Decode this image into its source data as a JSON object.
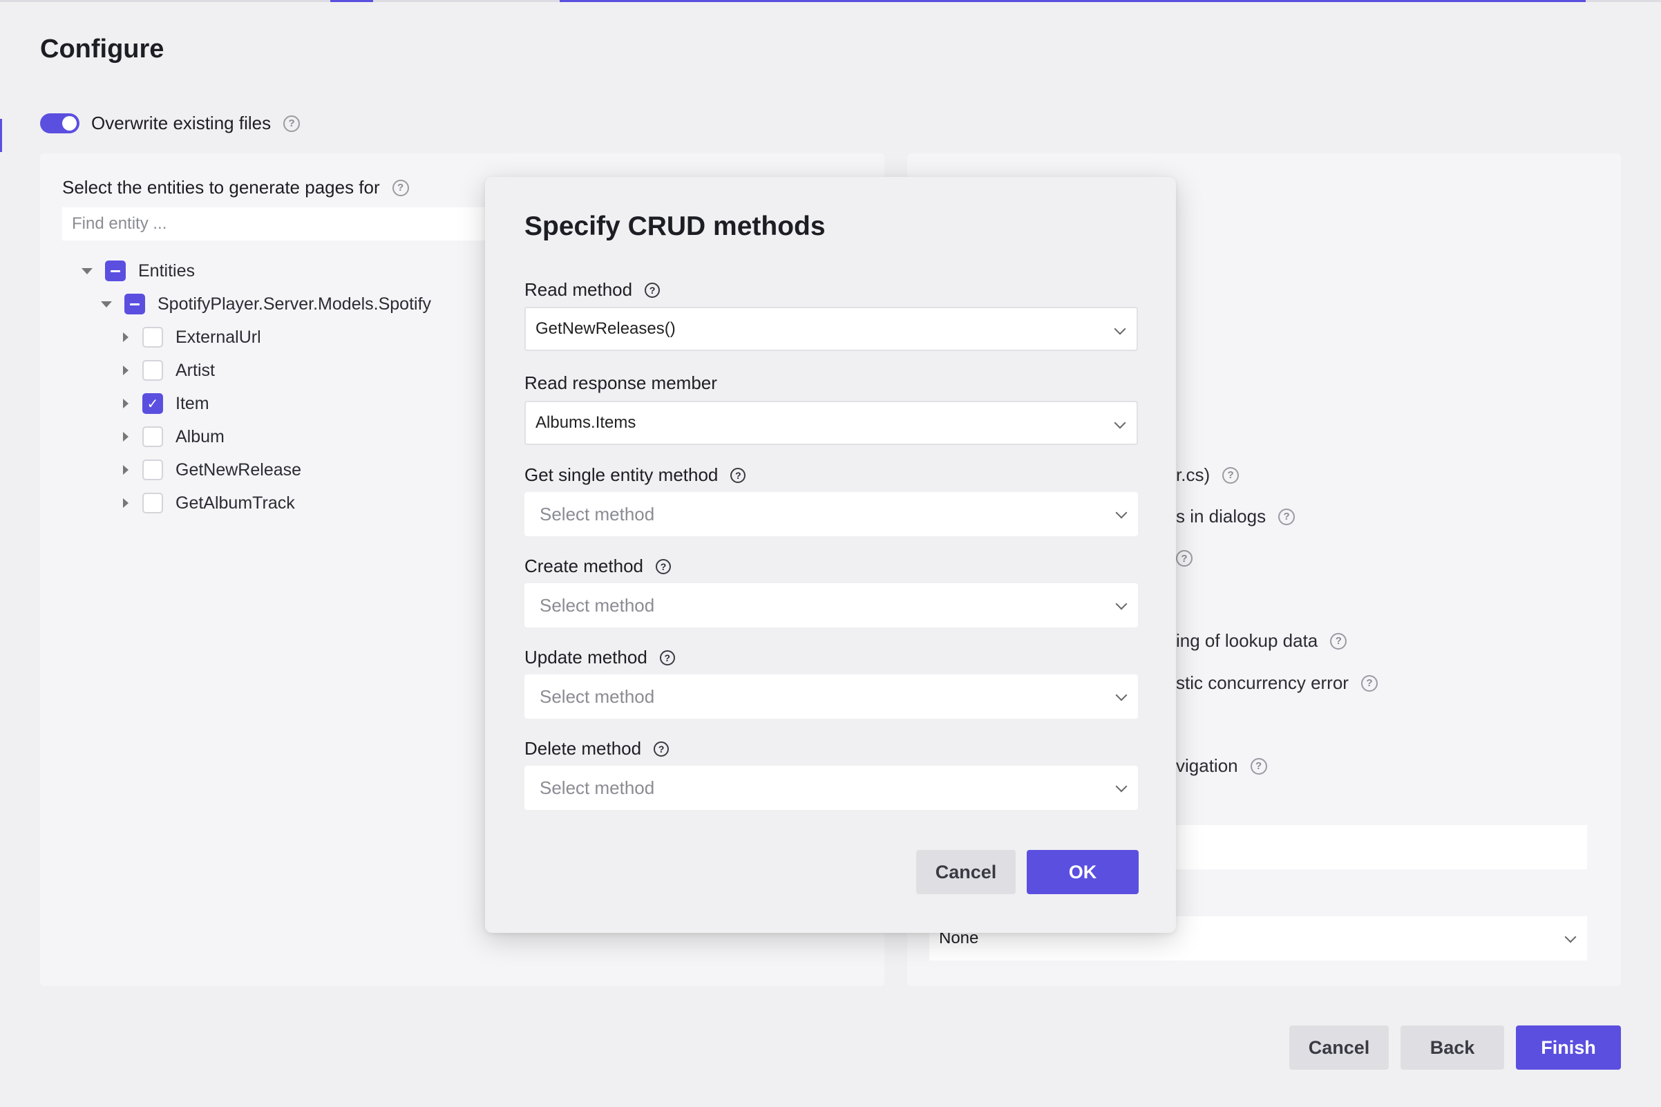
{
  "page": {
    "title": "Configure",
    "overwrite_label": "Overwrite existing files",
    "overwrite_on": true
  },
  "left_panel": {
    "heading": "Select the entities to generate pages for",
    "search_placeholder": "Find entity ...",
    "tree": {
      "root": "Entities",
      "namespace": "SpotifyPlayer.Server.Models.Spotify",
      "items": [
        {
          "label": "ExternalUrl",
          "checked": false
        },
        {
          "label": "Artist",
          "checked": false
        },
        {
          "label": "Item",
          "checked": true
        },
        {
          "label": "Album",
          "checked": false
        },
        {
          "label": "GetNewRelease",
          "checked": false
        },
        {
          "label": "GetAlbumTrack",
          "checked": false
        }
      ]
    }
  },
  "right_panel": {
    "frag1": "r.cs)",
    "frag2": "s in dialogs",
    "frag3": "ing of lookup data",
    "frag4": "stic concurrency error",
    "frag5": "vigation",
    "select_value": "None"
  },
  "footer": {
    "cancel": "Cancel",
    "back": "Back",
    "finish": "Finish"
  },
  "modal": {
    "title": "Specify CRUD methods",
    "read_label": "Read method",
    "read_value": "GetNewReleases()",
    "response_label": "Read response member",
    "response_value": "Albums.Items",
    "single_label": "Get single entity method",
    "single_placeholder": "Select method",
    "create_label": "Create method",
    "create_placeholder": "Select method",
    "update_label": "Update method",
    "update_placeholder": "Select method",
    "delete_label": "Delete method",
    "delete_placeholder": "Select method",
    "cancel": "Cancel",
    "ok": "OK"
  },
  "colors": {
    "accent": "#5b4fe0",
    "background": "#f0f0f2",
    "panel": "#f5f5f7"
  }
}
